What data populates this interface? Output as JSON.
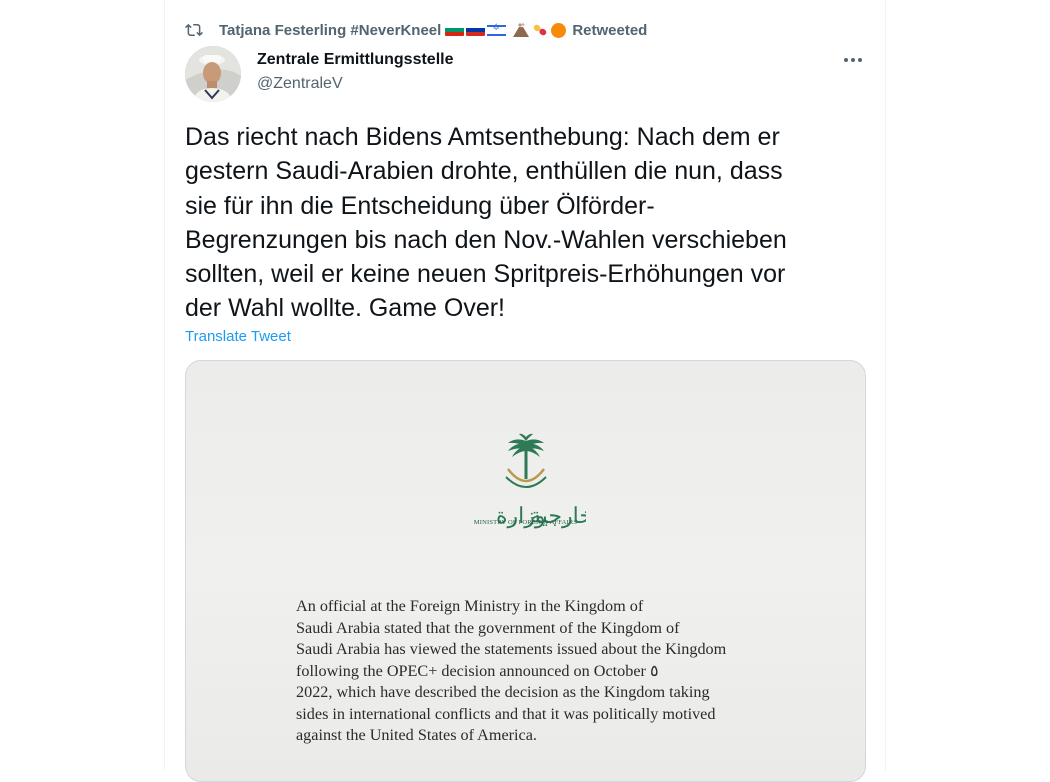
{
  "retweet": {
    "user": "Tatjana Festerling #NeverKneel",
    "suffix": "Retweeted",
    "icon": "retweet-icon",
    "emojis": [
      "bulgaria-flag",
      "russia-flag",
      "israel-flag",
      "volcano-emoji",
      "pill-emoji",
      "orange-circle-emoji"
    ]
  },
  "author": {
    "name": "Zentrale Ermittlungsstelle",
    "handle": "@ZentraleV"
  },
  "tweet": {
    "text": "Das riecht nach Bidens Amtsenthebung: Nach dem er\ngestern Saudi-Arabien drohte, enthüllen die nun, dass\nsie für ihn die Entscheidung über Ölförder-\nBegrenzungen bis nach den Nov.-Wahlen verschieben\nsollten, weil er keine neuen Spritpreis-Erhöhungen vor\nder Wahl wollte. Game Over!",
    "translate_label": "Translate Tweet"
  },
  "media": {
    "ministry_label": "MINISTRY OF FOREIGN AFFAIRS",
    "statement": "An official at the Foreign Ministry in the Kingdom of\nSaudi  Arabia stated that the government of the Kingdom of\nSaudi  Arabia has viewed the statements issued about the Kingdom\nfollowing the OPEC+ decision announced on    October ٥\n2022, which have described the decision as the Kingdom taking\nsides in international conflicts and that it was politically motived\nagainst the United States of America."
  },
  "colors": {
    "text": "#0f1419",
    "secondary": "#536471",
    "link": "#1d9bf0",
    "border": "#cfd9de",
    "emblem_green": "#1f5e44"
  }
}
